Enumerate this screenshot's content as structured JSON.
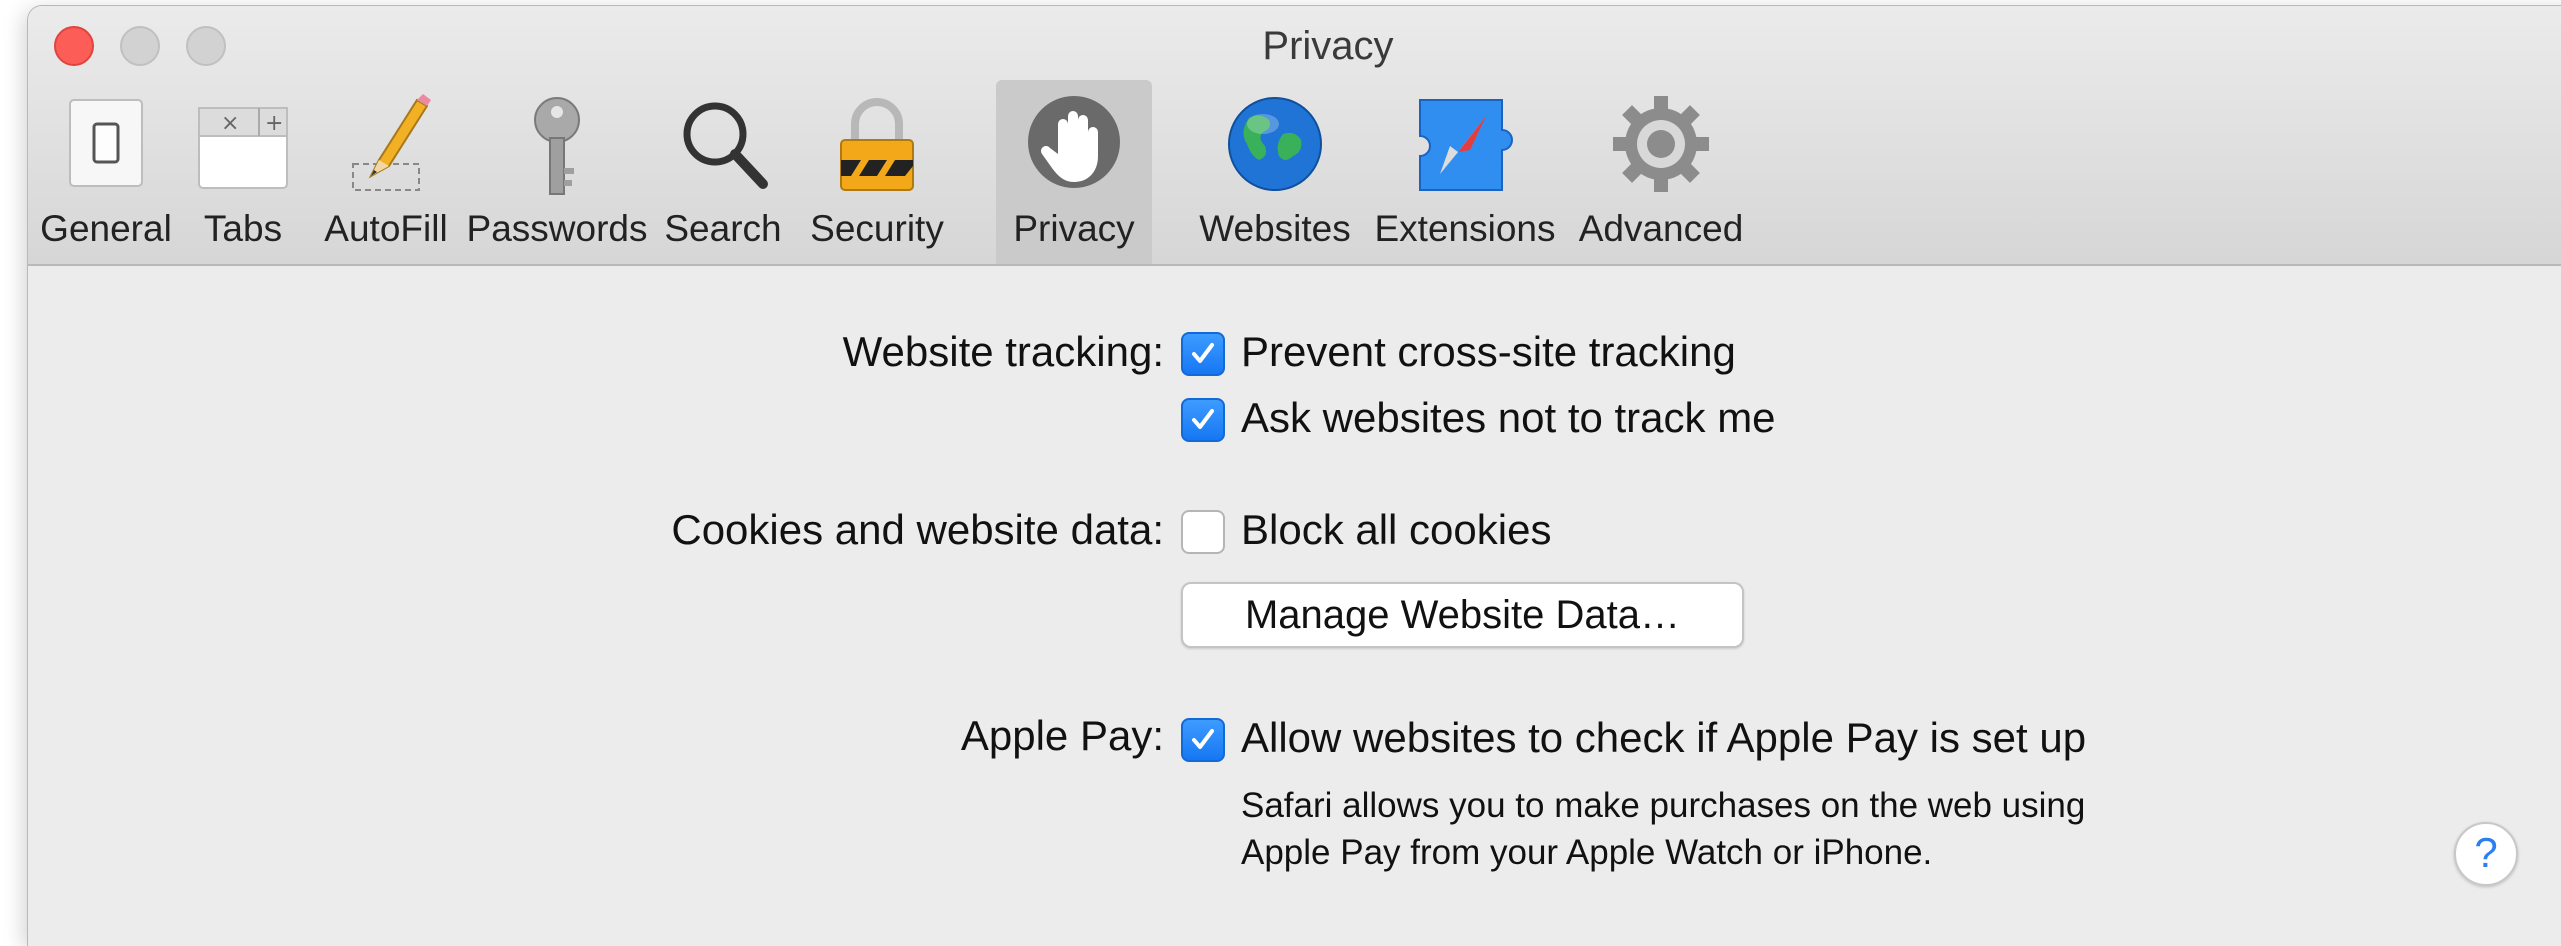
{
  "window": {
    "title": "Privacy"
  },
  "toolbar": {
    "items": [
      {
        "label": "General",
        "icon": "general-switch-icon"
      },
      {
        "label": "Tabs",
        "icon": "tabs-icon"
      },
      {
        "label": "AutoFill",
        "icon": "pencil-icon"
      },
      {
        "label": "Passwords",
        "icon": "key-icon"
      },
      {
        "label": "Search",
        "icon": "magnifier-icon"
      },
      {
        "label": "Security",
        "icon": "padlock-icon"
      },
      {
        "label": "Privacy",
        "icon": "hand-icon",
        "selected": true
      },
      {
        "label": "Websites",
        "icon": "globe-icon"
      },
      {
        "label": "Extensions",
        "icon": "puzzle-compass-icon"
      },
      {
        "label": "Advanced",
        "icon": "gear-icon"
      }
    ]
  },
  "privacy": {
    "website_tracking": {
      "label": "Website tracking:",
      "prevent_cross_site": {
        "label": "Prevent cross-site tracking",
        "checked": true
      },
      "ask_not_track": {
        "label": "Ask websites not to track me",
        "checked": true
      }
    },
    "cookies": {
      "label": "Cookies and website data:",
      "block_all": {
        "label": "Block all cookies",
        "checked": false
      },
      "manage_button": "Manage Website Data…"
    },
    "apple_pay": {
      "label": "Apple Pay:",
      "allow_check": {
        "label": "Allow websites to check if Apple Pay is set up",
        "checked": true
      },
      "description_line1": "Safari allows you to make purchases on the web using",
      "description_line2": "Apple Pay from your Apple Watch or iPhone."
    }
  },
  "help_button": "?",
  "colors": {
    "accent": "#1677f3",
    "close": "#fc5d57",
    "selected_tab": "#cacaca"
  }
}
